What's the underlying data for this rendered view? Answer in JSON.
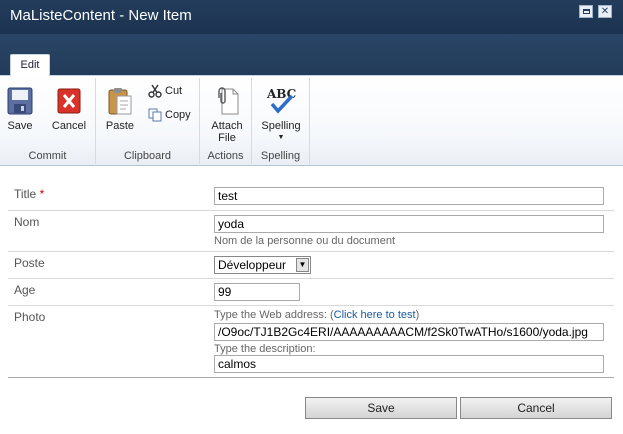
{
  "window": {
    "title": "MaListeContent - New Item"
  },
  "ribbon": {
    "tab": "Edit",
    "groups": {
      "commit": {
        "label": "Commit",
        "save": "Save",
        "cancel": "Cancel"
      },
      "clipboard": {
        "label": "Clipboard",
        "paste": "Paste",
        "cut": "Cut",
        "copy": "Copy"
      },
      "actions": {
        "label": "Actions",
        "attach_line1": "Attach",
        "attach_line2": "File"
      },
      "spelling": {
        "label": "Spelling",
        "spelling": "Spelling",
        "icon_text": "ABC"
      }
    }
  },
  "form": {
    "title": {
      "label": "Title",
      "required_mark": "*",
      "value": "test"
    },
    "nom": {
      "label": "Nom",
      "value": "yoda",
      "hint": "Nom de la personne ou du document"
    },
    "poste": {
      "label": "Poste",
      "value": "Développeur"
    },
    "age": {
      "label": "Age",
      "value": "99"
    },
    "photo": {
      "label": "Photo",
      "url_hint_prefix": "Type the Web address: (",
      "url_hint_link": "Click here to test",
      "url_hint_suffix": ")",
      "url_value": "/O9oc/TJ1B2Gc4ERI/AAAAAAAAACM/f2Sk0TwATHo/s1600/yoda.jpg",
      "desc_hint": "Type the description:",
      "desc_value": "calmos"
    }
  },
  "buttons": {
    "save": "Save",
    "cancel": "Cancel"
  },
  "colors": {
    "title_bar": "#243d5c",
    "required": "#bf0000",
    "link": "#1a5aa0"
  }
}
